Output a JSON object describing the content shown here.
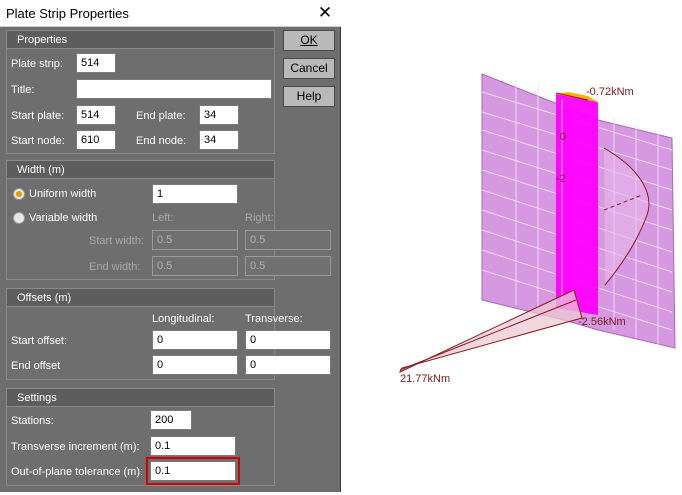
{
  "dialog": {
    "title": "Plate Strip Properties",
    "buttons": {
      "ok": "OK",
      "cancel": "Cancel",
      "help": "Help"
    },
    "properties": {
      "header": "Properties",
      "plate_strip_label": "Plate strip:",
      "plate_strip_value": "514",
      "title_label": "Title:",
      "title_value": "",
      "start_plate_label": "Start plate:",
      "start_plate_value": "514",
      "end_plate_label": "End plate:",
      "end_plate_value": "34",
      "start_node_label": "Start node:",
      "start_node_value": "610",
      "end_node_label": "End node:",
      "end_node_value": "34"
    },
    "width": {
      "header": "Width (m)",
      "uniform_label": "Uniform width",
      "uniform_value": "1",
      "variable_label": "Variable width",
      "left_label": "Left:",
      "right_label": "Right:",
      "start_width_label": "Start width:",
      "start_left_value": "0.5",
      "start_right_value": "0.5",
      "end_width_label": "End width:",
      "end_left_value": "0.5",
      "end_right_value": "0.5"
    },
    "offsets": {
      "header": "Offsets (m)",
      "longitudinal_label": "Longitudinal:",
      "transverse_label": "Transverse:",
      "start_offset_label": "Start offset:",
      "start_long_value": "0",
      "start_trans_value": "0",
      "end_offset_label": "End offset",
      "end_long_value": "0",
      "end_trans_value": "0"
    },
    "settings": {
      "header": "Settings",
      "stations_label": "Stations:",
      "stations_value": "200",
      "transverse_increment_label": "Transverse increment (m):",
      "transverse_increment_value": "0.1",
      "tolerance_label": "Out-of-plane tolerance (m):",
      "tolerance_value": "0.1"
    }
  },
  "viewport": {
    "label_top": "-0.72kNm",
    "label_zero": "0",
    "label_minus": "-2",
    "label_bottom": "-2.56kNm",
    "label_left": "21.77kNm",
    "colors": {
      "plate": "#d98ce6",
      "strip": "#ff00ff",
      "diagram": "#8b1a1a"
    }
  }
}
